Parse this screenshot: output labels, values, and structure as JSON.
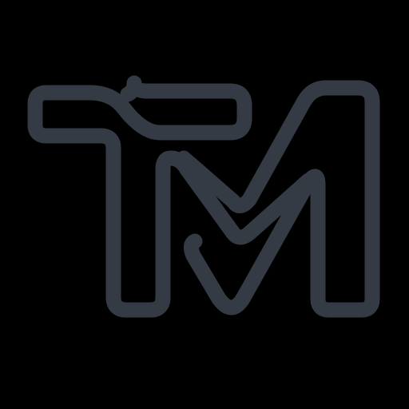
{
  "logo": {
    "icon": "tm-monogram-logo-icon",
    "colors": {
      "background": "#000000",
      "stroke": "#353b44"
    }
  }
}
